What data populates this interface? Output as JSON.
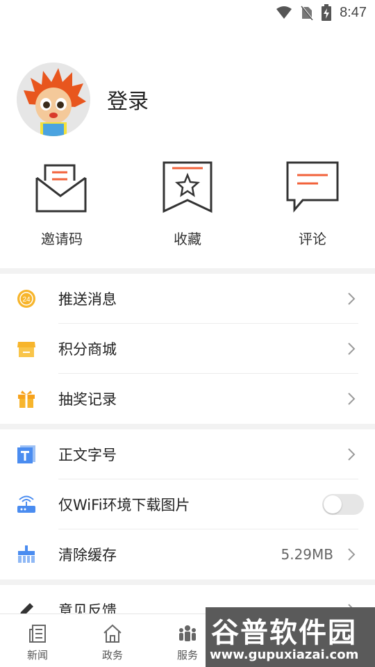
{
  "status_bar": {
    "time": "8:47"
  },
  "profile": {
    "login_label": "登录"
  },
  "quick_actions": [
    {
      "label": "邀请码",
      "icon": "envelope-icon"
    },
    {
      "label": "收藏",
      "icon": "bookmark-star-icon"
    },
    {
      "label": "评论",
      "icon": "comment-icon"
    }
  ],
  "menu_group_1": [
    {
      "label": "推送消息",
      "icon": "clock-24-icon"
    },
    {
      "label": "积分商城",
      "icon": "store-icon"
    },
    {
      "label": "抽奖记录",
      "icon": "gift-icon"
    }
  ],
  "menu_group_2": {
    "font_size": {
      "label": "正文字号"
    },
    "wifi_only": {
      "label": "仅WiFi环境下载图片",
      "enabled": false
    },
    "clear_cache": {
      "label": "清除缓存",
      "value": "5.29MB"
    }
  },
  "menu_group_3": [
    {
      "label": "意见反馈",
      "icon": "pencil-icon"
    }
  ],
  "tabbar": {
    "tabs": [
      {
        "label": "新闻",
        "icon": "newspaper-icon"
      },
      {
        "label": "政务",
        "icon": "home-icon"
      },
      {
        "label": "服务",
        "icon": "people-icon"
      }
    ]
  },
  "watermark": {
    "title": "谷普软件园",
    "url": "www.gupuxiazai.com"
  },
  "colors": {
    "accent_orange": "#f2613a",
    "icon_yellow": "#f7b52c",
    "icon_blue": "#4a8cf0"
  }
}
